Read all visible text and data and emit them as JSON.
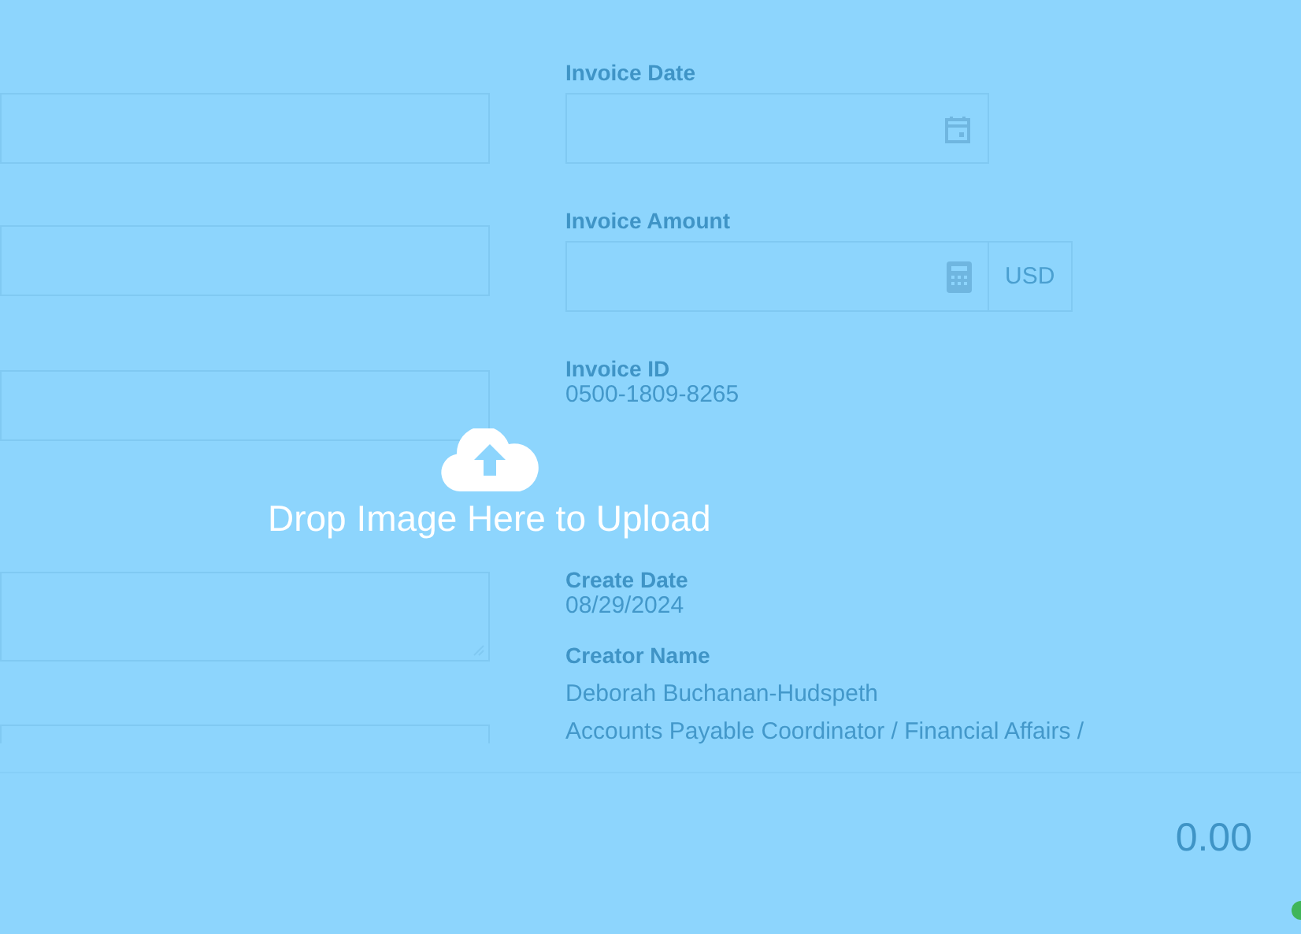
{
  "left_fields": [
    {
      "kind": "input"
    },
    {
      "kind": "input"
    },
    {
      "kind": "input"
    },
    {
      "kind": "textarea"
    },
    {
      "kind": "input"
    }
  ],
  "invoice_date": {
    "label": "Invoice Date"
  },
  "invoice_amount": {
    "label": "Invoice Amount",
    "currency": "USD"
  },
  "invoice_id": {
    "label": "Invoice ID",
    "value": "0500-1809-8265"
  },
  "create_date": {
    "label": "Create Date",
    "value": "08/29/2024"
  },
  "creator": {
    "label": "Creator Name",
    "name": "Deborah Buchanan-Hudspeth",
    "title": "Accounts Payable Coordinator / Financial Affairs /"
  },
  "total": {
    "value": "0.00"
  },
  "overlay": {
    "message": "Drop Image Here to Upload"
  }
}
